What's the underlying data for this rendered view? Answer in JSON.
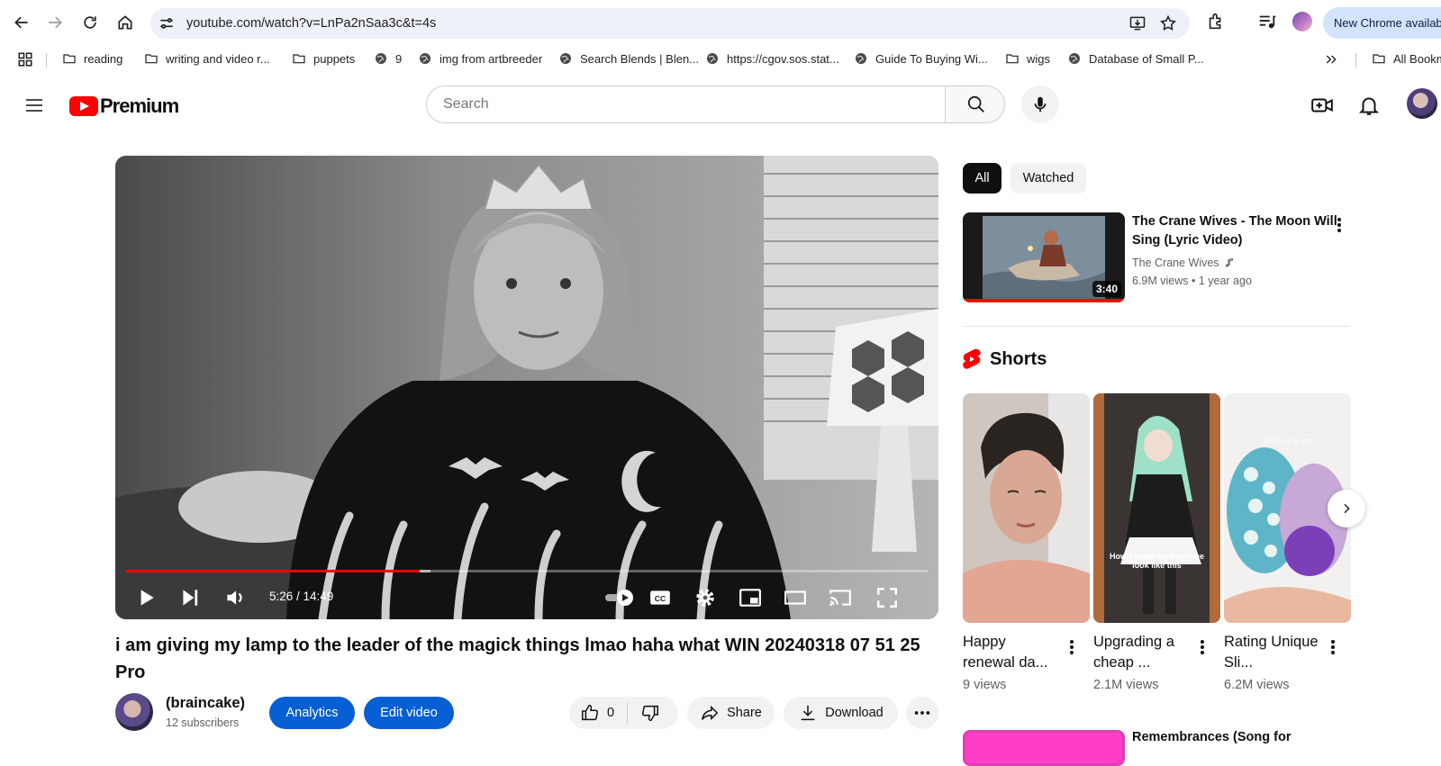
{
  "browser": {
    "url": "youtube.com/watch?v=LnPa2nSaa3c&t=4s",
    "new_chrome_label": "New Chrome availab",
    "bookmarks": [
      {
        "label": "reading",
        "icon": "folder-icon"
      },
      {
        "label": "writing and video r...",
        "icon": "folder-icon"
      },
      {
        "label": "puppets",
        "icon": "folder-icon"
      },
      {
        "label": "9",
        "icon": "globe-icon"
      },
      {
        "label": "img from artbreeder",
        "icon": "globe-icon"
      },
      {
        "label": "Search Blends | Blen...",
        "icon": "globe-icon"
      },
      {
        "label": "https://cgov.sos.stat...",
        "icon": "globe-icon"
      },
      {
        "label": "Guide To Buying Wi...",
        "icon": "globe-icon"
      },
      {
        "label": "wigs",
        "icon": "folder-icon"
      },
      {
        "label": "Database of Small P...",
        "icon": "globe-icon"
      }
    ],
    "all_bookmarks_label": "All Bookm"
  },
  "masthead": {
    "brand": "Premium",
    "search_placeholder": "Search"
  },
  "player": {
    "time_display": "5:26 / 14:49",
    "progress_fraction": 0.366,
    "buffered_fraction": 0.38
  },
  "video": {
    "title": "i am giving my lamp to the leader of the magick things lmao haha what WIN 20240318 07 51 25 Pro",
    "channel_name": "(braincake)",
    "subscribers": "12 subscribers",
    "analytics_label": "Analytics",
    "edit_label": "Edit video",
    "like_count": "0",
    "share_label": "Share",
    "download_label": "Download"
  },
  "sidebar": {
    "chips": [
      "All",
      "Watched"
    ],
    "recommendation": {
      "title": "The Crane Wives - The Moon Will Sing (Lyric Video)",
      "channel": "The Crane Wives",
      "meta": "6.9M views • 1 year ago",
      "duration": "3:40"
    },
    "shorts_label": "Shorts",
    "shorts": [
      {
        "title": "Happy renewal da...",
        "views": "9 views"
      },
      {
        "title": "Upgrading a cheap ...",
        "views": "2.1M views",
        "caption": "How I made my costume look like this"
      },
      {
        "title": "Rating Unique Sli...",
        "views": "6.2M views",
        "caption": "which one for you"
      }
    ],
    "next_recommendation_title": "Remembrances (Song for"
  },
  "colors": {
    "youtube_red": "#ff0000",
    "action_blue": "#065fd4",
    "chip_active": "#0f0f0f",
    "omnibox_bg": "#eef1f8"
  }
}
